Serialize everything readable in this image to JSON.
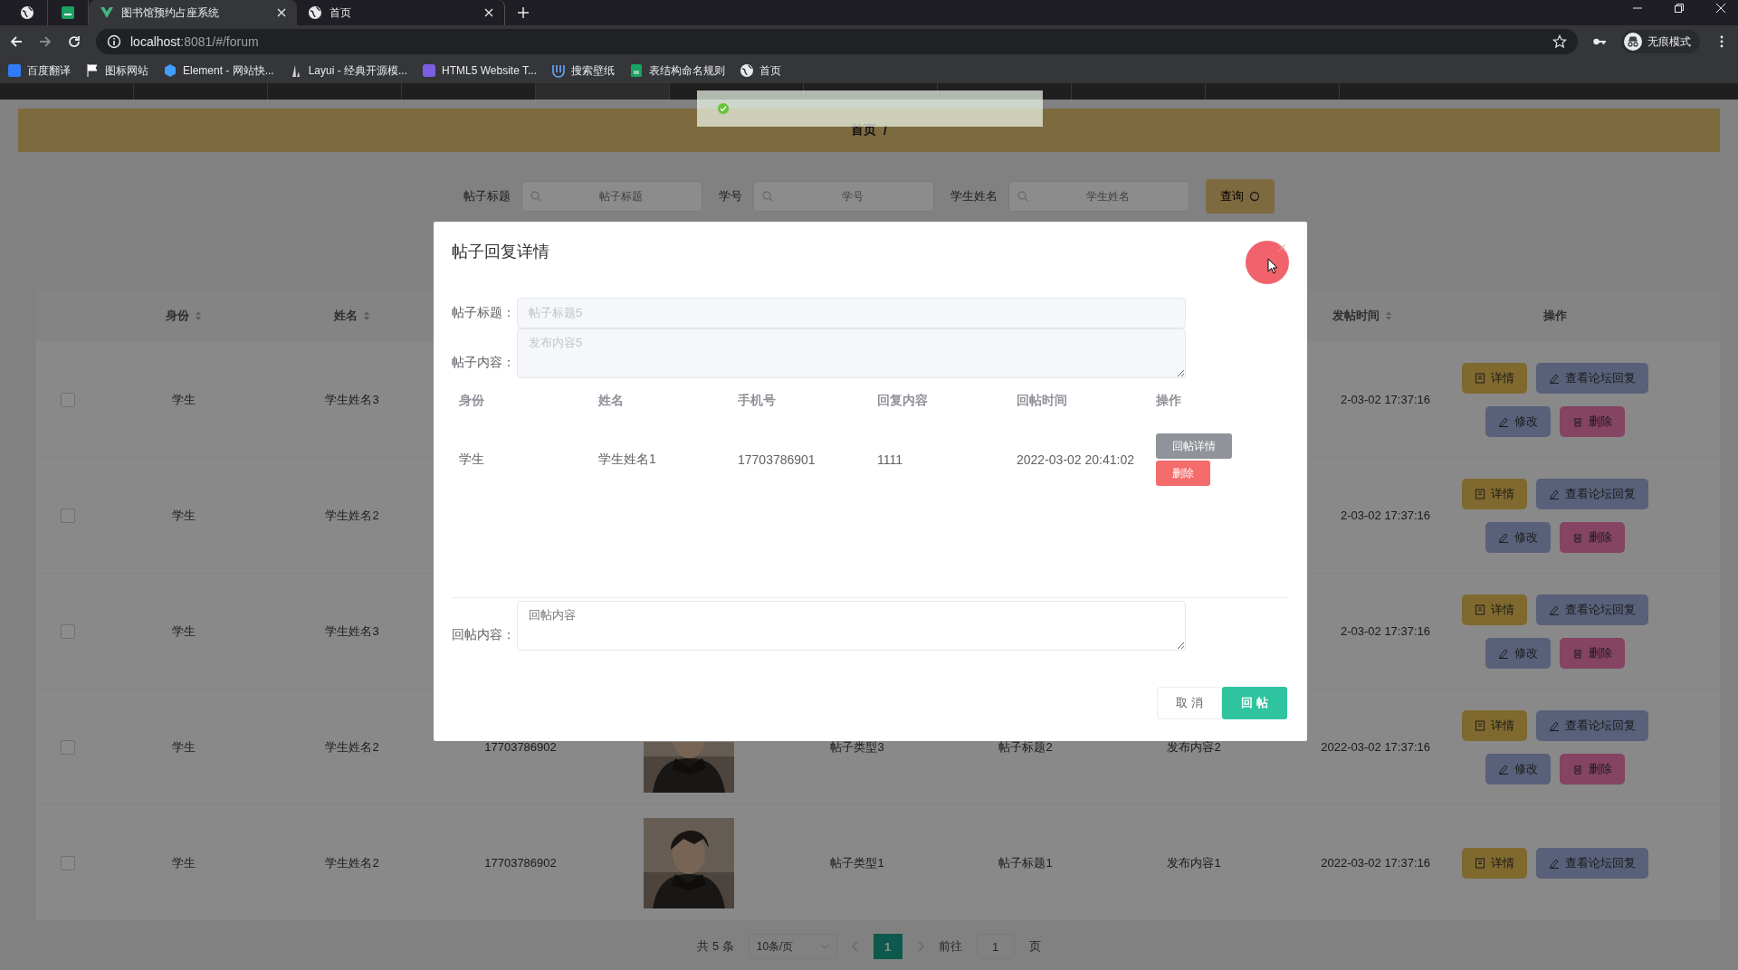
{
  "browser": {
    "tabs": [
      {
        "kind": "globe",
        "selected": false
      },
      {
        "kind": "app",
        "selected": false
      },
      {
        "kind": "vue",
        "title": "图书馆预约占座系统",
        "selected": true
      },
      {
        "kind": "globe",
        "title": "首页",
        "selected": false
      }
    ],
    "address": {
      "host": "localhost",
      "rest": ":8081/#/forum"
    },
    "profile": "无痕模式",
    "bookmarks": [
      {
        "kind": "translate",
        "label": "百度翻译"
      },
      {
        "kind": "flag",
        "label": "图标网站"
      },
      {
        "kind": "element",
        "label": "Element - 网站快..."
      },
      {
        "kind": "layui",
        "label": "Layui - 经典开源模..."
      },
      {
        "kind": "html5",
        "label": "HTML5 Website T..."
      },
      {
        "kind": "wallpaper",
        "label": "搜索壁纸"
      },
      {
        "kind": "sheet",
        "label": "表结构命名规则"
      },
      {
        "kind": "globe",
        "label": "首页"
      }
    ]
  },
  "breadcrumb": {
    "items": [
      "首页"
    ],
    "separator": "/"
  },
  "filters": [
    {
      "label": "帖子标题",
      "placeholder": "帖子标题"
    },
    {
      "label": "学号",
      "placeholder": "学号"
    },
    {
      "label": "学生姓名",
      "placeholder": "学生姓名"
    }
  ],
  "search_button": "查询",
  "table": {
    "columns": {
      "identity": {
        "label": "身份",
        "sortable": true
      },
      "name": {
        "label": "姓名",
        "sortable": true
      },
      "time": {
        "label": "发帖时间",
        "sortable": true
      },
      "actions": {
        "label": "操作"
      }
    },
    "rows": [
      {
        "checked": false,
        "identity": "学生",
        "name": "学生姓名3",
        "time": "2-03-02 17:37:16",
        "actions": [
          {
            "kind": "detail",
            "label": "详情"
          },
          {
            "kind": "view",
            "label": "查看论坛回复"
          },
          {
            "kind": "edit",
            "label": "修改"
          },
          {
            "kind": "delete",
            "label": "删除"
          }
        ]
      },
      {
        "checked": false,
        "identity": "学生",
        "name": "学生姓名2",
        "time": "2-03-02 17:37:16",
        "actions": [
          {
            "kind": "detail",
            "label": "详情"
          },
          {
            "kind": "view",
            "label": "查看论坛回复"
          },
          {
            "kind": "edit",
            "label": "修改"
          },
          {
            "kind": "delete",
            "label": "删除"
          }
        ]
      },
      {
        "checked": false,
        "identity": "学生",
        "name": "学生姓名3",
        "time": "2-03-02 17:37:16",
        "actions": [
          {
            "kind": "detail",
            "label": "详情"
          },
          {
            "kind": "view",
            "label": "查看论坛回复"
          },
          {
            "kind": "edit",
            "label": "修改"
          },
          {
            "kind": "delete",
            "label": "删除"
          }
        ]
      },
      {
        "checked": false,
        "identity": "学生",
        "name": "学生姓名2",
        "phone": "17703786902",
        "photo": {
          "kind": "picture"
        },
        "type": "帖子类型3",
        "title": "帖子标题2",
        "content": "发布内容2",
        "time": "2022-03-02 17:37:16",
        "actions": [
          {
            "kind": "detail",
            "label": "详情"
          },
          {
            "kind": "view",
            "label": "查看论坛回复"
          },
          {
            "kind": "edit",
            "label": "修改"
          },
          {
            "kind": "delete",
            "label": "删除"
          }
        ]
      },
      {
        "checked": false,
        "identity": "学生",
        "name": "学生姓名2",
        "phone": "17703786902",
        "photo": {
          "kind": "picture"
        },
        "type": "帖子类型1",
        "title": "帖子标题1",
        "content": "发布内容1",
        "time": "2022-03-02 17:37:16",
        "actions": [
          {
            "kind": "detail",
            "label": "详情"
          },
          {
            "kind": "view",
            "label": "查看论坛回复"
          }
        ]
      }
    ]
  },
  "pagination": {
    "total": "共 5 条",
    "page_size": "10条/页",
    "pages": [
      {
        "label": "1",
        "selected": true
      }
    ],
    "jump_label": "前往",
    "jump_value": "1",
    "jump_unit": "页"
  },
  "dialog": {
    "title": "帖子回复详情",
    "fields": [
      {
        "kind": "input",
        "label": "帖子标题：",
        "value": "帖子标题5",
        "disabled": true
      },
      {
        "kind": "textarea",
        "label": "帖子内容：",
        "value": "发布内容5",
        "disabled": true
      }
    ],
    "replies": {
      "columns": [
        "身份",
        "姓名",
        "手机号",
        "回复内容",
        "回帖时间",
        "操作"
      ],
      "rows": [
        {
          "cells": [
            "学生",
            "学生姓名1",
            "17703786901",
            "1111",
            "2022-03-02 20:41:02"
          ],
          "actions": [
            {
              "kind": "info",
              "label": "回帖详情"
            },
            {
              "kind": "danger",
              "label": "删除"
            }
          ]
        }
      ]
    },
    "reply_field": {
      "label": "回帖内容：",
      "placeholder": "回帖内容"
    },
    "buttons": [
      {
        "kind": "default",
        "label": "取 消"
      },
      {
        "kind": "primary",
        "label": "回 帖"
      }
    ]
  }
}
